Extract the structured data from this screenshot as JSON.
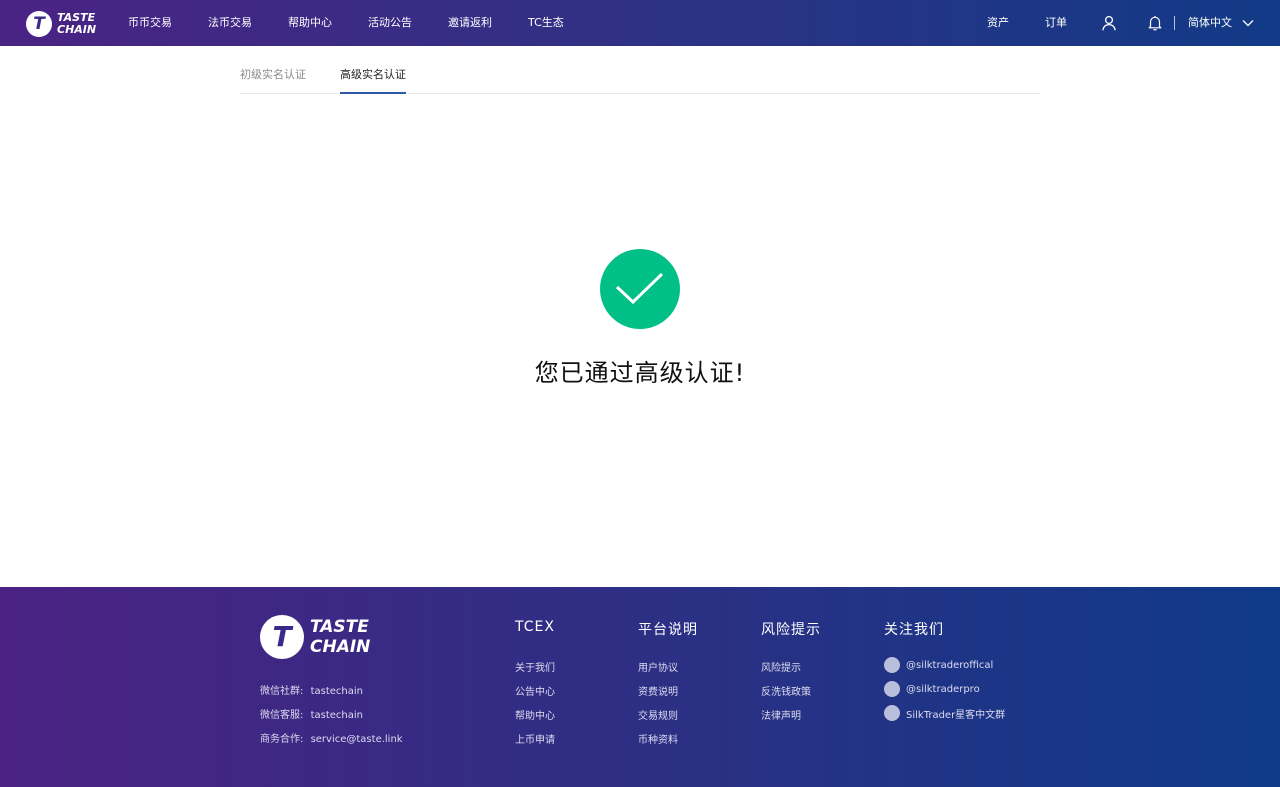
{
  "header": {
    "logo_line1": "TASTE",
    "logo_line2": "CHAIN",
    "logo_mark": "T",
    "nav": [
      {
        "label": "币币交易"
      },
      {
        "label": "法币交易"
      },
      {
        "label": "帮助中心"
      },
      {
        "label": "活动公告"
      },
      {
        "label": "邀请返利"
      },
      {
        "label": "TC生态"
      }
    ],
    "assets_label": "资产",
    "orders_label": "订单",
    "language_label": "简体中文",
    "icons": [
      "user-icon",
      "bell-icon",
      "chevron-down-icon"
    ]
  },
  "tabs": {
    "basic": "初级实名认证",
    "advanced": "高级实名认证"
  },
  "success": {
    "icon": "check-circle-icon",
    "color": "#00c087",
    "message": "您已通过高级认证!"
  },
  "footer": {
    "logo_line1": "TASTE",
    "logo_line2": "CHAIN",
    "logo_mark": "T",
    "info": [
      {
        "label": "微信社群:",
        "value": "tastechain"
      },
      {
        "label": "微信客服:",
        "value": "tastechain"
      },
      {
        "label": "商务合作:",
        "value": "service@taste.link"
      }
    ],
    "columns": [
      {
        "title": "TCEX",
        "links": [
          "关于我们",
          "公告中心",
          "帮助中心",
          "上币申请"
        ]
      },
      {
        "title": "平台说明",
        "links": [
          "用户协议",
          "资费说明",
          "交易规则",
          "币种资料"
        ]
      },
      {
        "title": "风险提示",
        "links": [
          "风险提示",
          "反洗钱政策",
          "法律声明"
        ]
      },
      {
        "title": "关注我们",
        "links": [
          "@silktraderoffical",
          "@silktraderpro",
          "SilkTrader星客中文群"
        ]
      }
    ]
  },
  "colors": {
    "header_start": "#4a2384",
    "header_end": "#123a86",
    "success": "#00c087",
    "tab_active_underline": "#2e5aa8"
  }
}
